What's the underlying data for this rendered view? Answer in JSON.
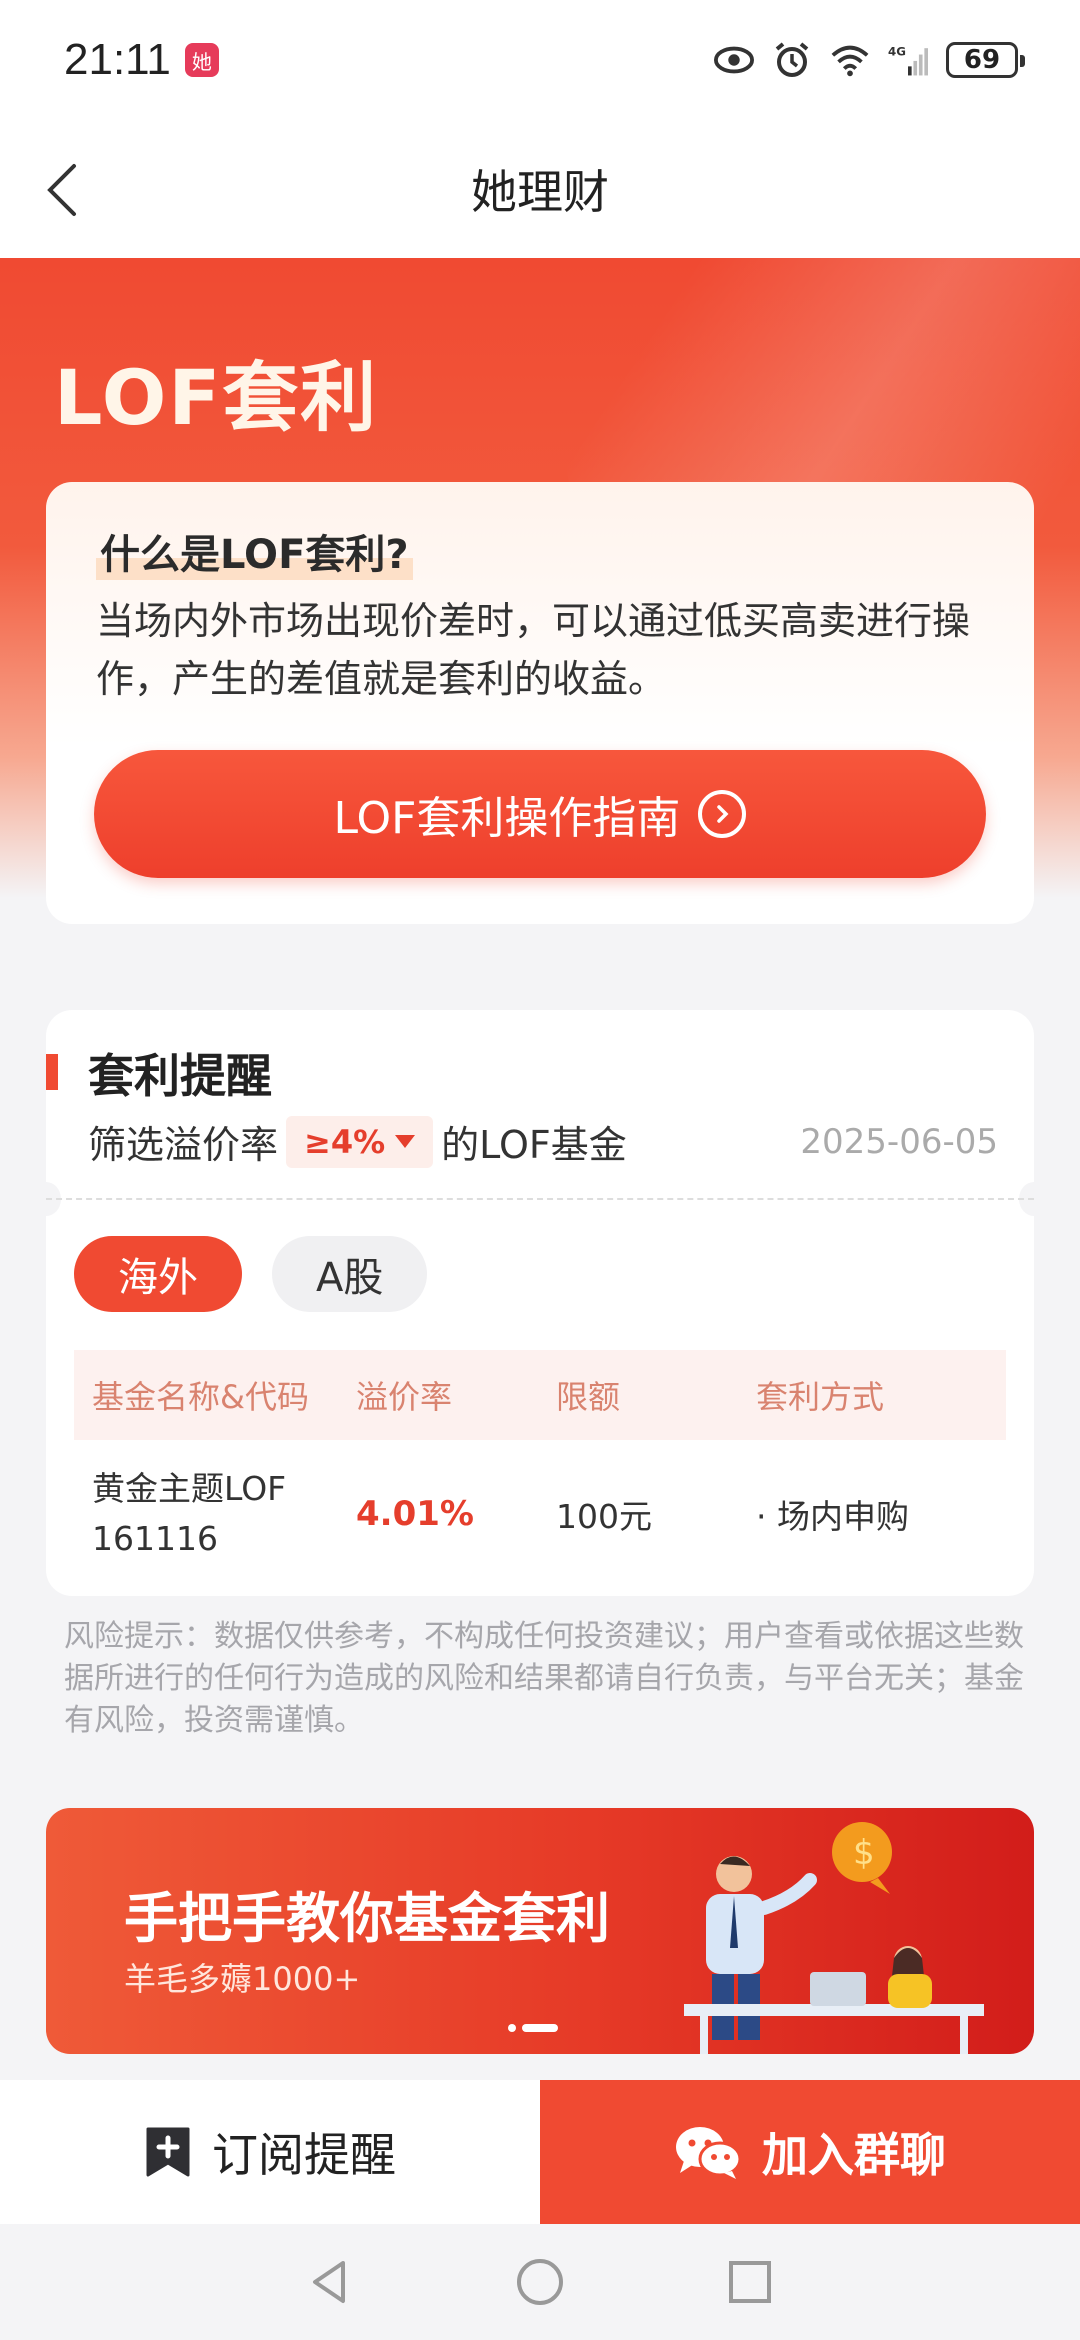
{
  "status_bar": {
    "time": "21:11",
    "app_badge": "她",
    "network": "4G",
    "battery": "69"
  },
  "nav": {
    "title": "她理财"
  },
  "hero": {
    "title": "LOF套利"
  },
  "intro": {
    "question": "什么是LOF套利?",
    "description": "当场内外市场出现价差时，可以通过低买高卖进行操作，产生的差值就是套利的收益。",
    "guide_button": "LOF套利操作指南"
  },
  "reminder": {
    "title": "套利提醒",
    "filter_prefix": "筛选溢价率",
    "filter_value": "≥4%",
    "filter_suffix": "的LOF基金",
    "date": "2025-06-05",
    "tabs": [
      {
        "label": "海外",
        "active": true
      },
      {
        "label": "A股",
        "active": false
      }
    ],
    "columns": [
      "基金名称&代码",
      "溢价率",
      "限额",
      "套利方式"
    ],
    "rows": [
      {
        "name": "黄金主题LOF",
        "code": "161116",
        "premium": "4.01%",
        "limit": "100元",
        "method": "· 场内申购"
      }
    ]
  },
  "risk_note": "风险提示：数据仅供参考，不构成任何投资建议；用户查看或依据这些数据所进行的任何行为造成的风险和结果都请自行负责，与平台无关；基金有风险，投资需谨慎。",
  "banner": {
    "title": "手把手教你基金套利",
    "subtitle": "羊毛多薅1000+"
  },
  "bottom_bar": {
    "subscribe_label": "订阅提醒",
    "join_label": "加入群聊"
  },
  "colors": {
    "accent": "#f04a32",
    "premium_red": "#e53e2c",
    "header_text": "#d9836f"
  }
}
